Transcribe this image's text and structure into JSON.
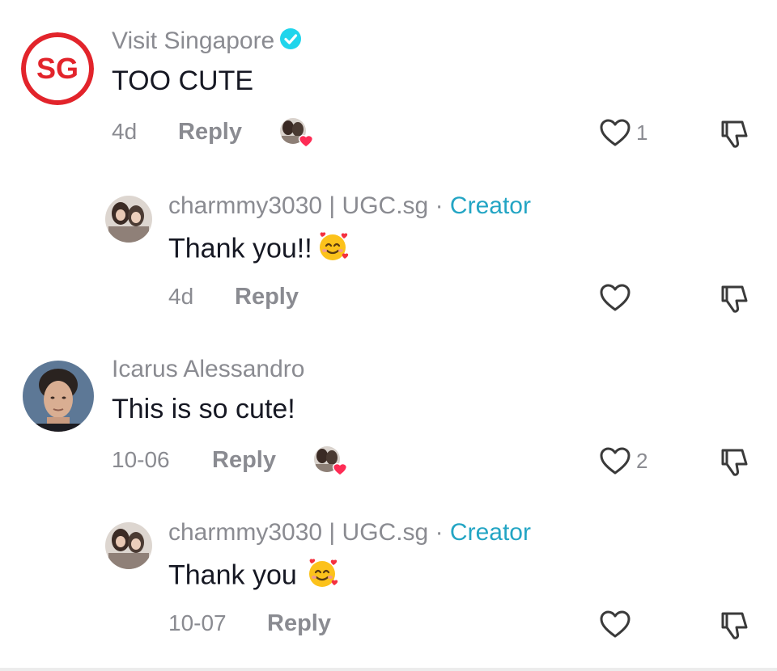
{
  "comments": [
    {
      "user": "Visit Singapore",
      "avatar_text": "SG",
      "verified": true,
      "text": "TOO CUTE",
      "date": "4d",
      "reply_label": "Reply",
      "likes": "1"
    },
    {
      "user": "charmmy3030 | UGC.sg",
      "creator_separator": "·",
      "creator_label": "Creator",
      "text": "Thank you!!",
      "date": "4d",
      "reply_label": "Reply"
    },
    {
      "user": "Icarus Alessandro",
      "text": "This is so cute!",
      "date": "10-06",
      "reply_label": "Reply",
      "likes": "2"
    },
    {
      "user": "charmmy3030 | UGC.sg",
      "creator_separator": "·",
      "creator_label": "Creator",
      "text": "Thank you",
      "date": "10-07",
      "reply_label": "Reply"
    }
  ],
  "colors": {
    "brand_red": "#e2242b",
    "creator_teal": "#23a5c4",
    "verified_blue": "#20d5ec",
    "muted_text": "#8a8b91",
    "heart_red": "#fe2c55"
  }
}
